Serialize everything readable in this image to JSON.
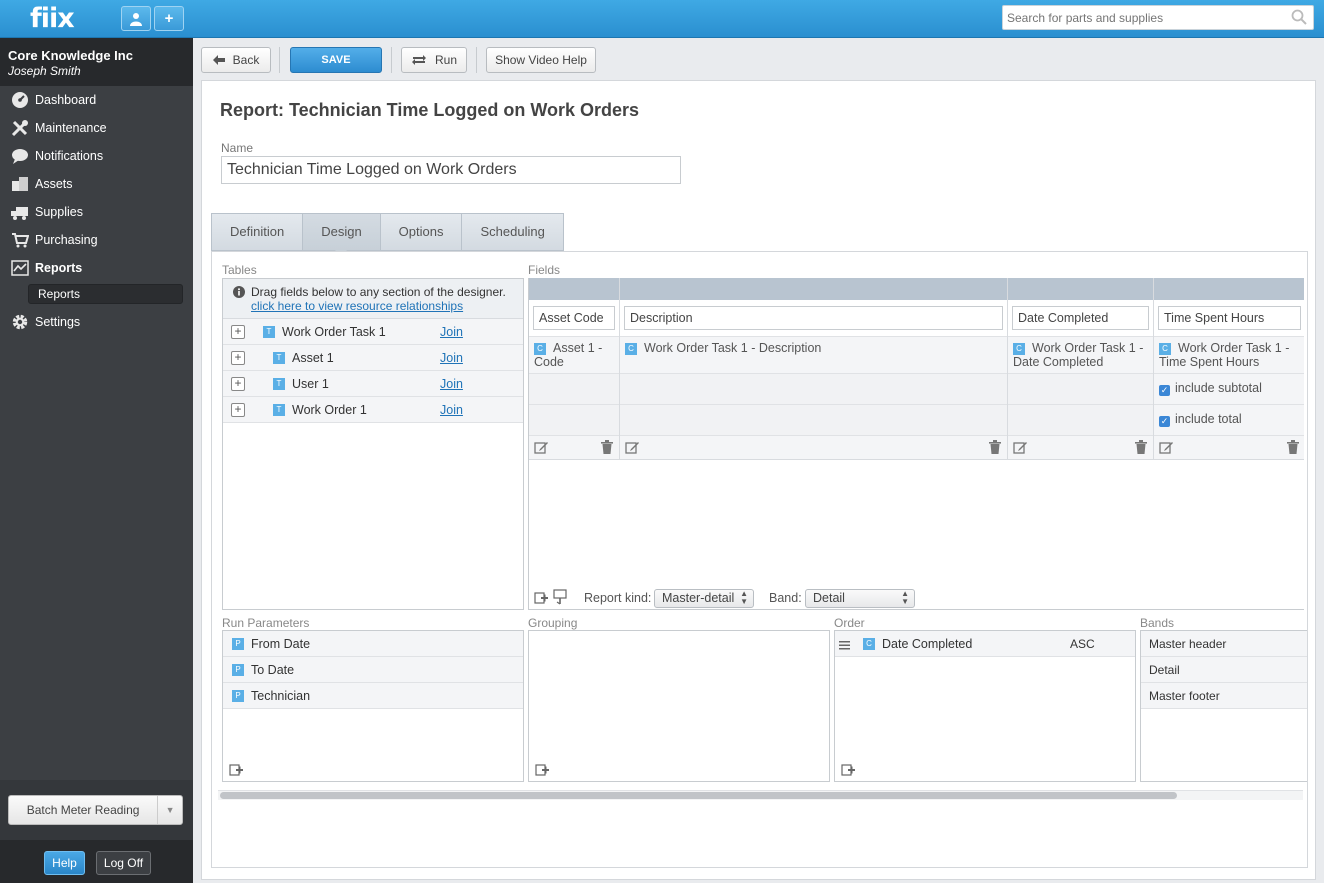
{
  "app": {
    "logo": "fiix"
  },
  "header": {
    "search_placeholder": "Search for parts and supplies"
  },
  "sidebar": {
    "company": "Core Knowledge Inc",
    "user": "Joseph Smith",
    "items": [
      {
        "label": "Dashboard",
        "icon": "dashboard-icon"
      },
      {
        "label": "Maintenance",
        "icon": "tools-icon"
      },
      {
        "label": "Notifications",
        "icon": "chat-bubble-icon"
      },
      {
        "label": "Assets",
        "icon": "boxes-icon"
      },
      {
        "label": "Supplies",
        "icon": "truck-icon"
      },
      {
        "label": "Purchasing",
        "icon": "cart-icon"
      },
      {
        "label": "Reports",
        "icon": "chart-icon"
      },
      {
        "label": "Settings",
        "icon": "gear-icon"
      }
    ],
    "sub_item": "Reports",
    "batch_button": "Batch Meter Reading",
    "help": "Help",
    "logoff": "Log Off"
  },
  "toolbar": {
    "back": "Back",
    "save": "SAVE",
    "run": "Run",
    "video_help": "Show Video Help"
  },
  "report": {
    "title": "Report: Technician Time Logged on Work Orders",
    "name_label": "Name",
    "name_value": "Technician Time Logged on Work Orders"
  },
  "tabs": [
    "Definition",
    "Design",
    "Options",
    "Scheduling"
  ],
  "designer": {
    "tables_label": "Tables",
    "info_text": "Drag fields below to any section of the designer.",
    "info_link": "click here to view resource relationships",
    "tables": [
      {
        "name": "Work Order Task 1",
        "join": "Join",
        "badge": "T"
      },
      {
        "name": "Asset 1",
        "join": "Join",
        "badge": "T"
      },
      {
        "name": "User 1",
        "join": "Join",
        "badge": "T"
      },
      {
        "name": "Work Order 1",
        "join": "Join",
        "badge": "T"
      }
    ],
    "fields_label": "Fields",
    "fields": [
      {
        "header": "Asset Code",
        "value": "Asset 1 - Code",
        "badge": "C",
        "subtotal": "",
        "total": ""
      },
      {
        "header": "Description",
        "value": "Work Order Task 1 - Description",
        "badge": "C",
        "subtotal": "",
        "total": ""
      },
      {
        "header": "Date Completed",
        "value": "Work Order Task 1 - Date Completed",
        "badge": "C",
        "subtotal": "",
        "total": ""
      },
      {
        "header": "Time Spent Hours",
        "value": "Work Order Task 1 - Time Spent Hours",
        "badge": "C",
        "subtotal": "include subtotal",
        "total": "include total"
      }
    ],
    "report_kind_label": "Report kind:",
    "report_kind": "Master-detail",
    "band_label": "Band:",
    "band": "Detail",
    "run_params_label": "Run Parameters",
    "run_params": [
      {
        "name": "From Date",
        "badge": "P"
      },
      {
        "name": "To Date",
        "badge": "P"
      },
      {
        "name": "Technician",
        "badge": "P"
      }
    ],
    "grouping_label": "Grouping",
    "order_label": "Order",
    "order": [
      {
        "name": "Date Completed",
        "badge": "C",
        "dir": "ASC"
      }
    ],
    "bands_label": "Bands",
    "bands": [
      "Master header",
      "Detail",
      "Master footer"
    ]
  },
  "colors": {
    "accent": "#2d8cd0",
    "sidebar_bg": "#3c3f43",
    "link": "#1f73b7",
    "badge": "#5aafe6"
  }
}
